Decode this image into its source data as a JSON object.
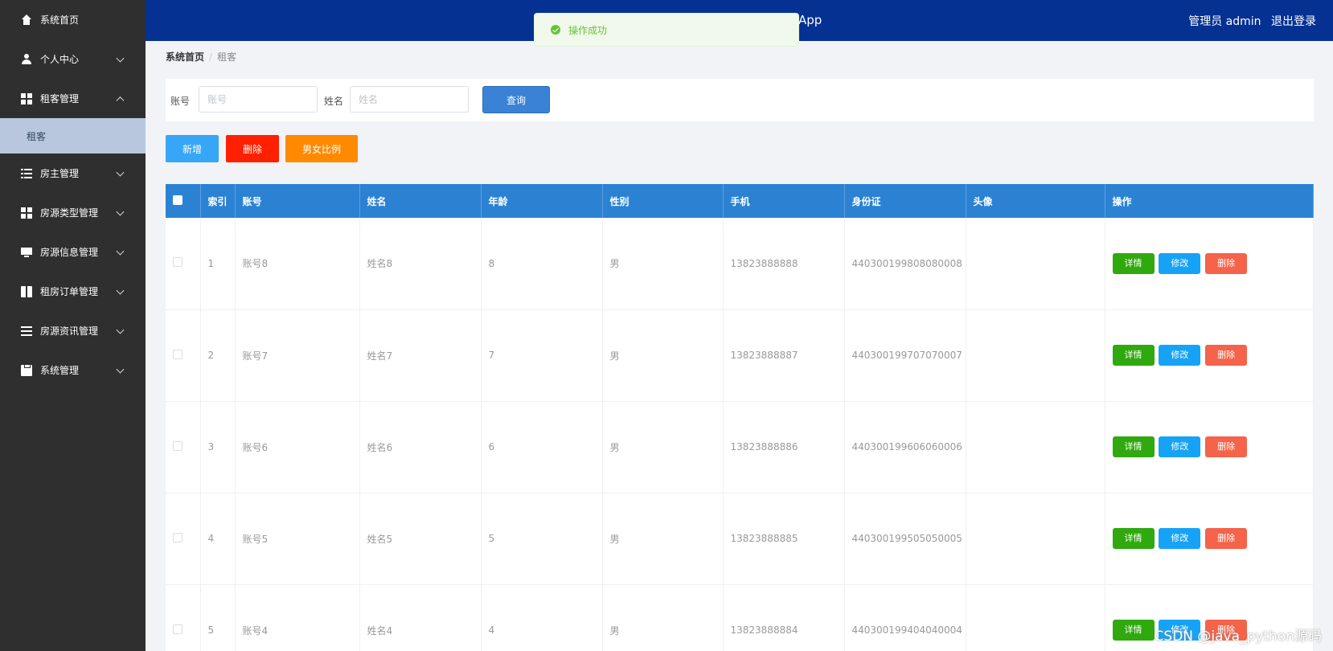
{
  "header": {
    "title": "App",
    "user_label": "管理员 admin",
    "logout": "退出登录"
  },
  "toast": {
    "text": "操作成功"
  },
  "sidebar": {
    "items": [
      {
        "label": "系统首页",
        "icon": "home-icon"
      },
      {
        "label": "个人中心",
        "icon": "user-icon"
      },
      {
        "label": "租客管理",
        "icon": "grid-icon"
      },
      {
        "label": "租客",
        "icon": ""
      },
      {
        "label": "房主管理",
        "icon": "list-icon"
      },
      {
        "label": "房源类型管理",
        "icon": "grid-icon"
      },
      {
        "label": "房源信息管理",
        "icon": "monitor-icon"
      },
      {
        "label": "租房订单管理",
        "icon": "book-icon"
      },
      {
        "label": "房源资讯管理",
        "icon": "bars-icon"
      },
      {
        "label": "系统管理",
        "icon": "clipboard-icon"
      }
    ]
  },
  "breadcrumb": {
    "home": "系统首页",
    "sep": "/",
    "current": "租客"
  },
  "search": {
    "account_label": "账号",
    "account_placeholder": "账号",
    "name_label": "姓名",
    "name_placeholder": "姓名",
    "query_button": "查询"
  },
  "actions": {
    "add": "新增",
    "delete": "删除",
    "ratio": "男女比例"
  },
  "table": {
    "headers": [
      "索引",
      "账号",
      "姓名",
      "年龄",
      "性别",
      "手机",
      "身份证",
      "头像",
      "操作"
    ],
    "op_labels": {
      "detail": "详情",
      "edit": "修改",
      "delete": "删除"
    },
    "rows": [
      [
        "1",
        "账号8",
        "姓名8",
        "8",
        "男",
        "13823888888",
        "440300199808080008",
        ""
      ],
      [
        "2",
        "账号7",
        "姓名7",
        "7",
        "男",
        "13823888887",
        "440300199707070007",
        ""
      ],
      [
        "3",
        "账号6",
        "姓名6",
        "6",
        "男",
        "13823888886",
        "440300199606060006",
        ""
      ],
      [
        "4",
        "账号5",
        "姓名5",
        "5",
        "男",
        "13823888885",
        "440300199505050005",
        ""
      ],
      [
        "5",
        "账号4",
        "姓名4",
        "4",
        "男",
        "13823888884",
        "440300199404040004",
        ""
      ]
    ]
  },
  "watermark": "CSDN @java_python源码",
  "colors": {
    "header": "#053193",
    "sidebar": "#2f2f2f",
    "table_head": "#2b82d3"
  }
}
